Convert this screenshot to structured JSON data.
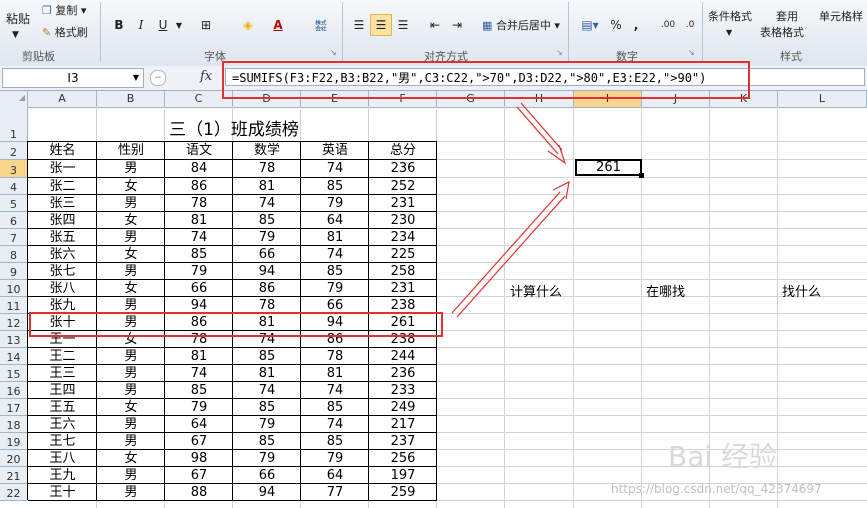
{
  "ribbon": {
    "paste": "粘贴",
    "copy": "复制",
    "format_painter": "格式刷",
    "bold": "B",
    "italic": "I",
    "underline": "U",
    "merge_center": "合并后居中",
    "percent": "%",
    "comma": ",",
    "inc_decimal": ".00",
    "dec_decimal": ".0",
    "conditional_format": "条件格式",
    "table_format_1": "套用",
    "table_format_2": "表格格式",
    "cell_styles": "单元格样",
    "groups": {
      "clipboard": "剪贴板",
      "font": "字体",
      "alignment": "对齐方式",
      "number": "数字",
      "styles": "样式"
    }
  },
  "formula_bar": {
    "name_box": "I3",
    "fx": "fx",
    "formula": "=SUMIFS(F3:F22,B3:B22,\"男\",C3:C22,\">70\",D3:D22,\">80\",E3:E22,\">90\")"
  },
  "columns": [
    "A",
    "B",
    "C",
    "D",
    "E",
    "F",
    "G",
    "H",
    "I",
    "J",
    "K",
    "L"
  ],
  "selected_column": "I",
  "selected_row": 3,
  "rows": [
    "1",
    "2",
    "3",
    "4",
    "5",
    "6",
    "7",
    "8",
    "9",
    "10",
    "11",
    "12",
    "13",
    "14",
    "15",
    "16",
    "17",
    "18",
    "19",
    "20",
    "21",
    "22"
  ],
  "title": "三（1）班成绩榜",
  "table": {
    "headers": [
      "姓名",
      "性别",
      "语文",
      "数学",
      "英语",
      "总分"
    ],
    "rows": [
      [
        "张一",
        "男",
        "84",
        "78",
        "74",
        "236"
      ],
      [
        "张二",
        "女",
        "86",
        "81",
        "85",
        "252"
      ],
      [
        "张三",
        "男",
        "78",
        "74",
        "79",
        "231"
      ],
      [
        "张四",
        "女",
        "81",
        "85",
        "64",
        "230"
      ],
      [
        "张五",
        "男",
        "74",
        "79",
        "81",
        "234"
      ],
      [
        "张六",
        "女",
        "85",
        "66",
        "74",
        "225"
      ],
      [
        "张七",
        "男",
        "79",
        "94",
        "85",
        "258"
      ],
      [
        "张八",
        "女",
        "66",
        "86",
        "79",
        "231"
      ],
      [
        "张九",
        "男",
        "94",
        "78",
        "66",
        "238"
      ],
      [
        "张十",
        "男",
        "86",
        "81",
        "94",
        "261"
      ],
      [
        "王一",
        "女",
        "78",
        "74",
        "86",
        "238"
      ],
      [
        "王二",
        "男",
        "81",
        "85",
        "78",
        "244"
      ],
      [
        "王三",
        "男",
        "74",
        "81",
        "81",
        "236"
      ],
      [
        "王四",
        "男",
        "85",
        "74",
        "74",
        "233"
      ],
      [
        "王五",
        "女",
        "79",
        "85",
        "85",
        "249"
      ],
      [
        "王六",
        "男",
        "64",
        "79",
        "74",
        "217"
      ],
      [
        "王七",
        "男",
        "67",
        "85",
        "85",
        "237"
      ],
      [
        "王八",
        "女",
        "98",
        "79",
        "79",
        "256"
      ],
      [
        "王九",
        "男",
        "67",
        "66",
        "64",
        "197"
      ],
      [
        "王十",
        "男",
        "88",
        "94",
        "77",
        "259"
      ]
    ]
  },
  "result_value": "261",
  "labels": {
    "what_to_calc": "计算什么",
    "where_to_find": "在哪找",
    "what_to_find": "找什么"
  },
  "watermark": {
    "brand": "Bai 经验",
    "url": "https://blog.csdn.net/qq_42374697"
  },
  "colors": {
    "annotation_red": "#e03030",
    "selected_header": "#f9d68c",
    "active_button": "#fbe3a3"
  }
}
